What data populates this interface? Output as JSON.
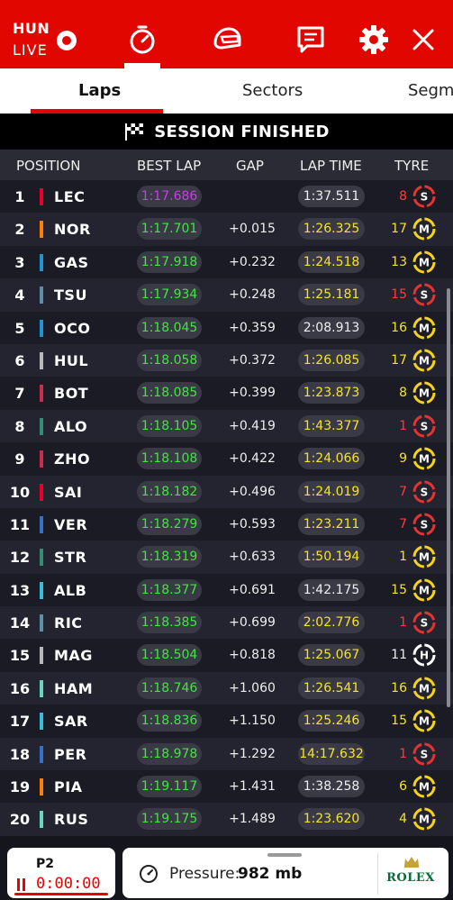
{
  "live": {
    "code": "HUN",
    "label": "LIVE"
  },
  "tabs": {
    "laps": "Laps",
    "sectors": "Sectors",
    "segments": "Segments"
  },
  "banner": {
    "text": "SESSION FINISHED"
  },
  "header": {
    "position": "POSITION",
    "best_lap": "BEST LAP",
    "gap": "GAP",
    "lap_time": "LAP TIME",
    "tyre": "TYRE"
  },
  "colors": {
    "accent": "#e10600",
    "personal_best": "#3ee63e",
    "overall_best": "#c93ce8",
    "lap_time_yellow": "#f5e22b",
    "soft": "#e3342f",
    "medium": "#f5d21d",
    "hard": "#ffffff"
  },
  "rows": [
    {
      "pos": "1",
      "code": "LEC",
      "team_color": "#e8002d",
      "best": "1:17.686",
      "best_color": "purple",
      "gap": "",
      "lap": "1:37.511",
      "lap_color": "white",
      "laps": "8",
      "laps_color": "red",
      "tyre": "S"
    },
    {
      "pos": "2",
      "code": "NOR",
      "team_color": "#ff8000",
      "best": "1:17.701",
      "best_color": "green",
      "gap": "+0.015",
      "lap": "1:26.325",
      "lap_color": "yellow",
      "laps": "17",
      "laps_color": "yellow",
      "tyre": "M"
    },
    {
      "pos": "3",
      "code": "GAS",
      "team_color": "#2293d1",
      "best": "1:17.918",
      "best_color": "green",
      "gap": "+0.232",
      "lap": "1:24.518",
      "lap_color": "yellow",
      "laps": "13",
      "laps_color": "yellow",
      "tyre": "M"
    },
    {
      "pos": "4",
      "code": "TSU",
      "team_color": "#5e8faa",
      "best": "1:17.934",
      "best_color": "green",
      "gap": "+0.248",
      "lap": "1:25.181",
      "lap_color": "yellow",
      "laps": "15",
      "laps_color": "red",
      "tyre": "S"
    },
    {
      "pos": "5",
      "code": "OCO",
      "team_color": "#2293d1",
      "best": "1:18.045",
      "best_color": "green",
      "gap": "+0.359",
      "lap": "2:08.913",
      "lap_color": "white",
      "laps": "16",
      "laps_color": "yellow",
      "tyre": "M"
    },
    {
      "pos": "6",
      "code": "HUL",
      "team_color": "#b6babd",
      "best": "1:18.058",
      "best_color": "green",
      "gap": "+0.372",
      "lap": "1:26.085",
      "lap_color": "yellow",
      "laps": "17",
      "laps_color": "yellow",
      "tyre": "M"
    },
    {
      "pos": "7",
      "code": "BOT",
      "team_color": "#c92d4b",
      "best": "1:18.085",
      "best_color": "green",
      "gap": "+0.399",
      "lap": "1:23.873",
      "lap_color": "yellow",
      "laps": "8",
      "laps_color": "yellow",
      "tyre": "M"
    },
    {
      "pos": "8",
      "code": "ALO",
      "team_color": "#358c75",
      "best": "1:18.105",
      "best_color": "green",
      "gap": "+0.419",
      "lap": "1:43.377",
      "lap_color": "yellow",
      "laps": "1",
      "laps_color": "red",
      "tyre": "S"
    },
    {
      "pos": "9",
      "code": "ZHO",
      "team_color": "#c92d4b",
      "best": "1:18.108",
      "best_color": "green",
      "gap": "+0.422",
      "lap": "1:24.066",
      "lap_color": "yellow",
      "laps": "9",
      "laps_color": "yellow",
      "tyre": "M"
    },
    {
      "pos": "10",
      "code": "SAI",
      "team_color": "#e8002d",
      "best": "1:18.182",
      "best_color": "green",
      "gap": "+0.496",
      "lap": "1:24.019",
      "lap_color": "yellow",
      "laps": "7",
      "laps_color": "red",
      "tyre": "S"
    },
    {
      "pos": "11",
      "code": "VER",
      "team_color": "#3671c6",
      "best": "1:18.279",
      "best_color": "green",
      "gap": "+0.593",
      "lap": "1:23.211",
      "lap_color": "yellow",
      "laps": "7",
      "laps_color": "red",
      "tyre": "S"
    },
    {
      "pos": "12",
      "code": "STR",
      "team_color": "#358c75",
      "best": "1:18.319",
      "best_color": "green",
      "gap": "+0.633",
      "lap": "1:50.194",
      "lap_color": "yellow",
      "laps": "1",
      "laps_color": "yellow",
      "tyre": "M"
    },
    {
      "pos": "13",
      "code": "ALB",
      "team_color": "#37bedd",
      "best": "1:18.377",
      "best_color": "green",
      "gap": "+0.691",
      "lap": "1:42.175",
      "lap_color": "white",
      "laps": "15",
      "laps_color": "yellow",
      "tyre": "M"
    },
    {
      "pos": "14",
      "code": "RIC",
      "team_color": "#5e8faa",
      "best": "1:18.385",
      "best_color": "green",
      "gap": "+0.699",
      "lap": "2:02.776",
      "lap_color": "yellow",
      "laps": "1",
      "laps_color": "red",
      "tyre": "S"
    },
    {
      "pos": "15",
      "code": "MAG",
      "team_color": "#b6babd",
      "best": "1:18.504",
      "best_color": "green",
      "gap": "+0.818",
      "lap": "1:25.067",
      "lap_color": "yellow",
      "laps": "11",
      "laps_color": "white",
      "tyre": "H"
    },
    {
      "pos": "16",
      "code": "HAM",
      "team_color": "#6cd3bf",
      "best": "1:18.746",
      "best_color": "green",
      "gap": "+1.060",
      "lap": "1:26.541",
      "lap_color": "yellow",
      "laps": "16",
      "laps_color": "yellow",
      "tyre": "M"
    },
    {
      "pos": "17",
      "code": "SAR",
      "team_color": "#37bedd",
      "best": "1:18.836",
      "best_color": "green",
      "gap": "+1.150",
      "lap": "1:25.246",
      "lap_color": "yellow",
      "laps": "15",
      "laps_color": "yellow",
      "tyre": "M"
    },
    {
      "pos": "18",
      "code": "PER",
      "team_color": "#3671c6",
      "best": "1:18.978",
      "best_color": "green",
      "gap": "+1.292",
      "lap": "14:17.632",
      "lap_color": "yellow",
      "laps": "1",
      "laps_color": "red",
      "tyre": "S"
    },
    {
      "pos": "19",
      "code": "PIA",
      "team_color": "#ff8000",
      "best": "1:19.117",
      "best_color": "green",
      "gap": "+1.431",
      "lap": "1:38.258",
      "lap_color": "white",
      "laps": "6",
      "laps_color": "yellow",
      "tyre": "M"
    },
    {
      "pos": "20",
      "code": "RUS",
      "team_color": "#6cd3bf",
      "best": "1:19.175",
      "best_color": "green",
      "gap": "+1.489",
      "lap": "1:23.620",
      "lap_color": "yellow",
      "laps": "4",
      "laps_color": "yellow",
      "tyre": "M"
    }
  ],
  "footer": {
    "session": "P2",
    "clock": "0:00:00",
    "pressure_label": "Pressure:",
    "pressure_value": "982 mb",
    "sponsor": "ROLEX"
  }
}
